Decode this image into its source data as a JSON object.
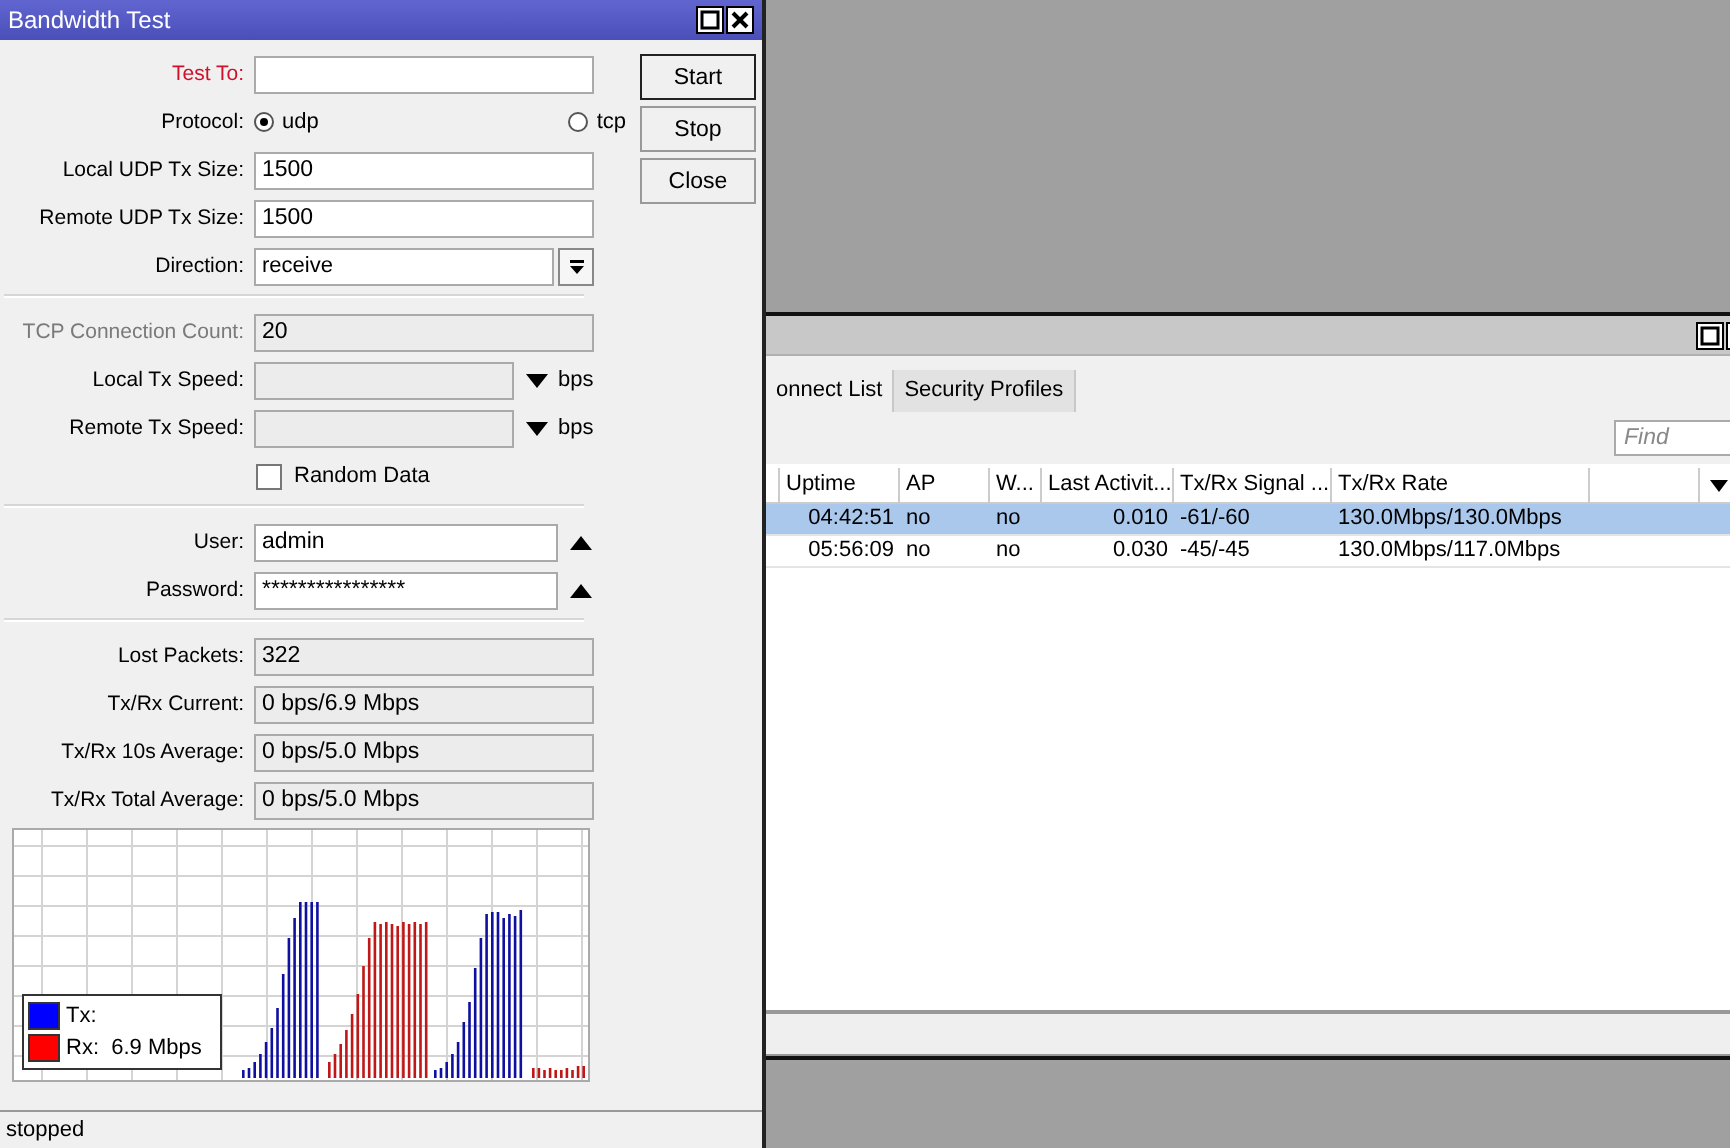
{
  "dialog": {
    "title": "Bandwidth Test",
    "sections": [
      {
        "fields": [
          {
            "kind": "text",
            "label": "Test To:",
            "required": true,
            "disabled": false
          },
          {
            "kind": "radio",
            "label": "Protocol:",
            "options": [
              {
                "label": "udp",
                "selected": true
              },
              {
                "label": "tcp",
                "selected": false
              }
            ]
          },
          {
            "kind": "text",
            "label": "Local UDP Tx Size:",
            "value": "1500",
            "required": false,
            "disabled": false
          },
          {
            "kind": "text",
            "label": "Remote UDP Tx Size:",
            "value": "1500",
            "required": false,
            "disabled": false
          },
          {
            "kind": "dropdown",
            "label": "Direction:",
            "value": "receive",
            "required": false,
            "disabled": false
          }
        ]
      },
      {
        "fields": [
          {
            "kind": "text",
            "label": "TCP Connection Count:",
            "value": "20",
            "required": false,
            "disabled": true
          },
          {
            "kind": "speed",
            "label": "Local Tx Speed:",
            "unit": "bps",
            "required": false,
            "disabled": false
          },
          {
            "kind": "speed",
            "label": "Remote Tx Speed:",
            "unit": "bps",
            "required": false,
            "disabled": false
          },
          {
            "kind": "checkbox",
            "label": "Random Data",
            "checked": false
          }
        ]
      },
      {
        "fields": [
          {
            "kind": "spin",
            "label": "User:",
            "value": "admin",
            "required": false,
            "disabled": false
          },
          {
            "kind": "spin",
            "label": "Password:",
            "value": "****************",
            "required": false,
            "disabled": false
          }
        ]
      },
      {
        "fields": [
          {
            "kind": "readonly",
            "label": "Lost Packets:",
            "value": "322",
            "required": false,
            "disabled": false
          },
          {
            "kind": "readonly",
            "label": "Tx/Rx Current:",
            "value": "0 bps/6.9 Mbps",
            "required": false,
            "disabled": false
          },
          {
            "kind": "readonly",
            "label": "Tx/Rx 10s Average:",
            "value": "0 bps/5.0 Mbps",
            "required": false,
            "disabled": false
          },
          {
            "kind": "readonly",
            "label": "Tx/Rx Total Average:",
            "value": "0 bps/5.0 Mbps",
            "required": false,
            "disabled": false
          }
        ]
      }
    ],
    "buttons": [
      {
        "label": "Start",
        "default": true
      },
      {
        "label": "Stop",
        "default": false
      },
      {
        "label": "Close",
        "default": false
      }
    ],
    "legend": [
      {
        "label": "Tx:",
        "color": "#0000ff"
      },
      {
        "label": "Rx:  6.9 Mbps",
        "color": "#ff0000"
      }
    ],
    "status": "stopped"
  },
  "registration_window": {
    "tabs": [
      {
        "label": "onnect List",
        "selected": false
      },
      {
        "label": "Security Profiles",
        "selected": false
      }
    ],
    "search": {
      "placeholder": "Find"
    },
    "columns": [
      "",
      "Uptime",
      "AP",
      "W...",
      "Last Activit...",
      "Tx/Rx Signal ...",
      "Tx/Rx Rate",
      ""
    ],
    "rows": [
      {
        "selected": true,
        "cells": [
          "",
          "04:42:51",
          "no",
          "no",
          "0.010",
          "-61/-60",
          "130.0Mbps/130.0Mbps",
          ""
        ]
      },
      {
        "selected": false,
        "cells": [
          "",
          "05:56:09",
          "no",
          "no",
          "0.030",
          "-45/-45",
          "130.0Mbps/117.0Mbps",
          ""
        ]
      }
    ]
  }
}
